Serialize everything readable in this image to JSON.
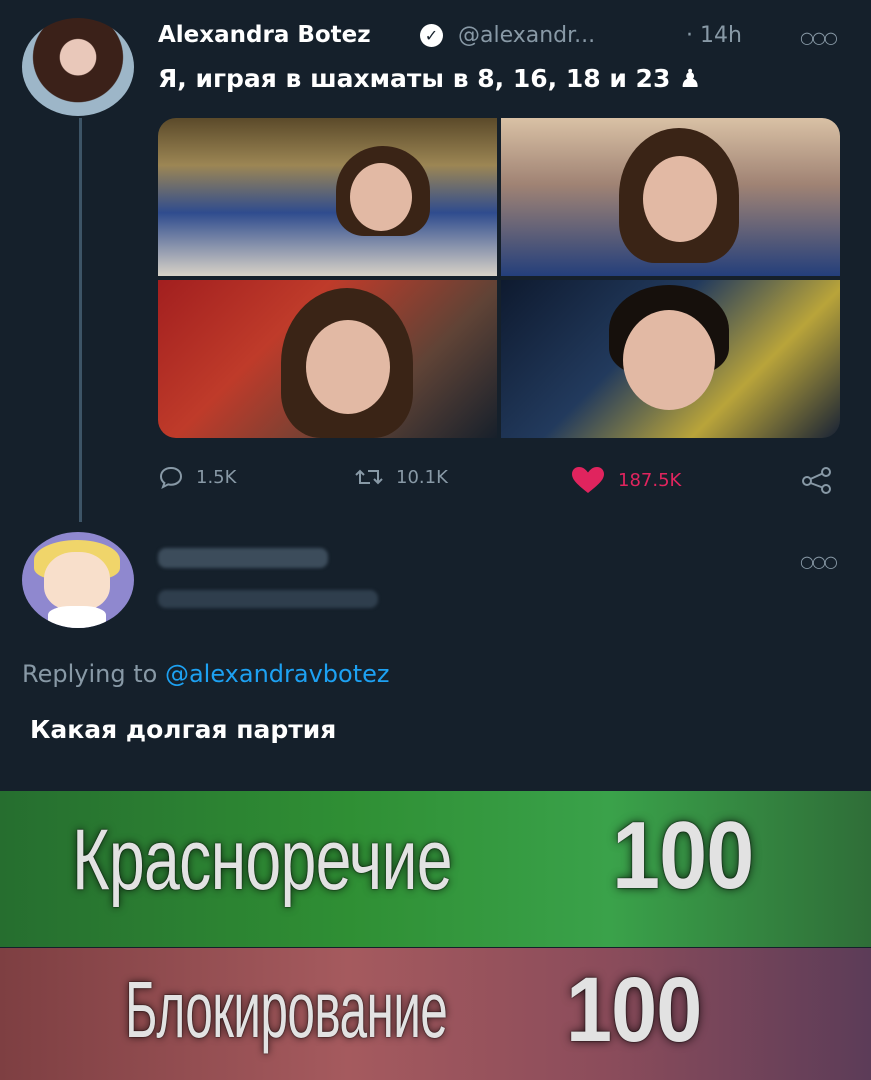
{
  "tweet": {
    "author_name": "Alexandra Botez",
    "author_handle": "@alexandr...",
    "time": "· 14h",
    "text": "Я, играя в шахматы в 8, 16, 18 и 23 ♟",
    "verified_icon": "verified-badge-icon",
    "stats": {
      "replies": "1.5K",
      "retweets": "10.1K",
      "likes": "187.5K"
    }
  },
  "reply": {
    "replying_prefix": "Replying to",
    "replying_to": "@alexandravbotez",
    "text": "Какая долгая партия"
  },
  "meme": {
    "line1_label": "Красноречие",
    "line1_value": "100",
    "line2_label": "Блокирование",
    "line2_value": "100"
  },
  "colors": {
    "background": "#15202b",
    "muted_text": "#8899a6",
    "link": "#1da1f2",
    "like": "#e0245e"
  }
}
